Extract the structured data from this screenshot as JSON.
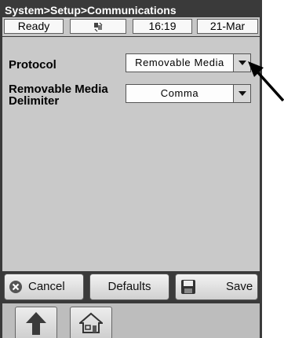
{
  "window": {
    "breadcrumb": "System>Setup>Communications"
  },
  "status_bar": {
    "state": "Ready",
    "icon": "connection-icon",
    "time": "16:19",
    "date": "21-Mar"
  },
  "settings": {
    "protocol": {
      "label": "Protocol",
      "value": "Removable Media"
    },
    "delimiter": {
      "label_line1": "Removable Media",
      "label_line2": "Delimiter",
      "value": "Comma"
    }
  },
  "buttons": {
    "cancel": "Cancel",
    "defaults": "Defaults",
    "save": "Save"
  },
  "nav": {
    "up_icon": "up-arrow-icon",
    "home_icon": "home-icon"
  }
}
